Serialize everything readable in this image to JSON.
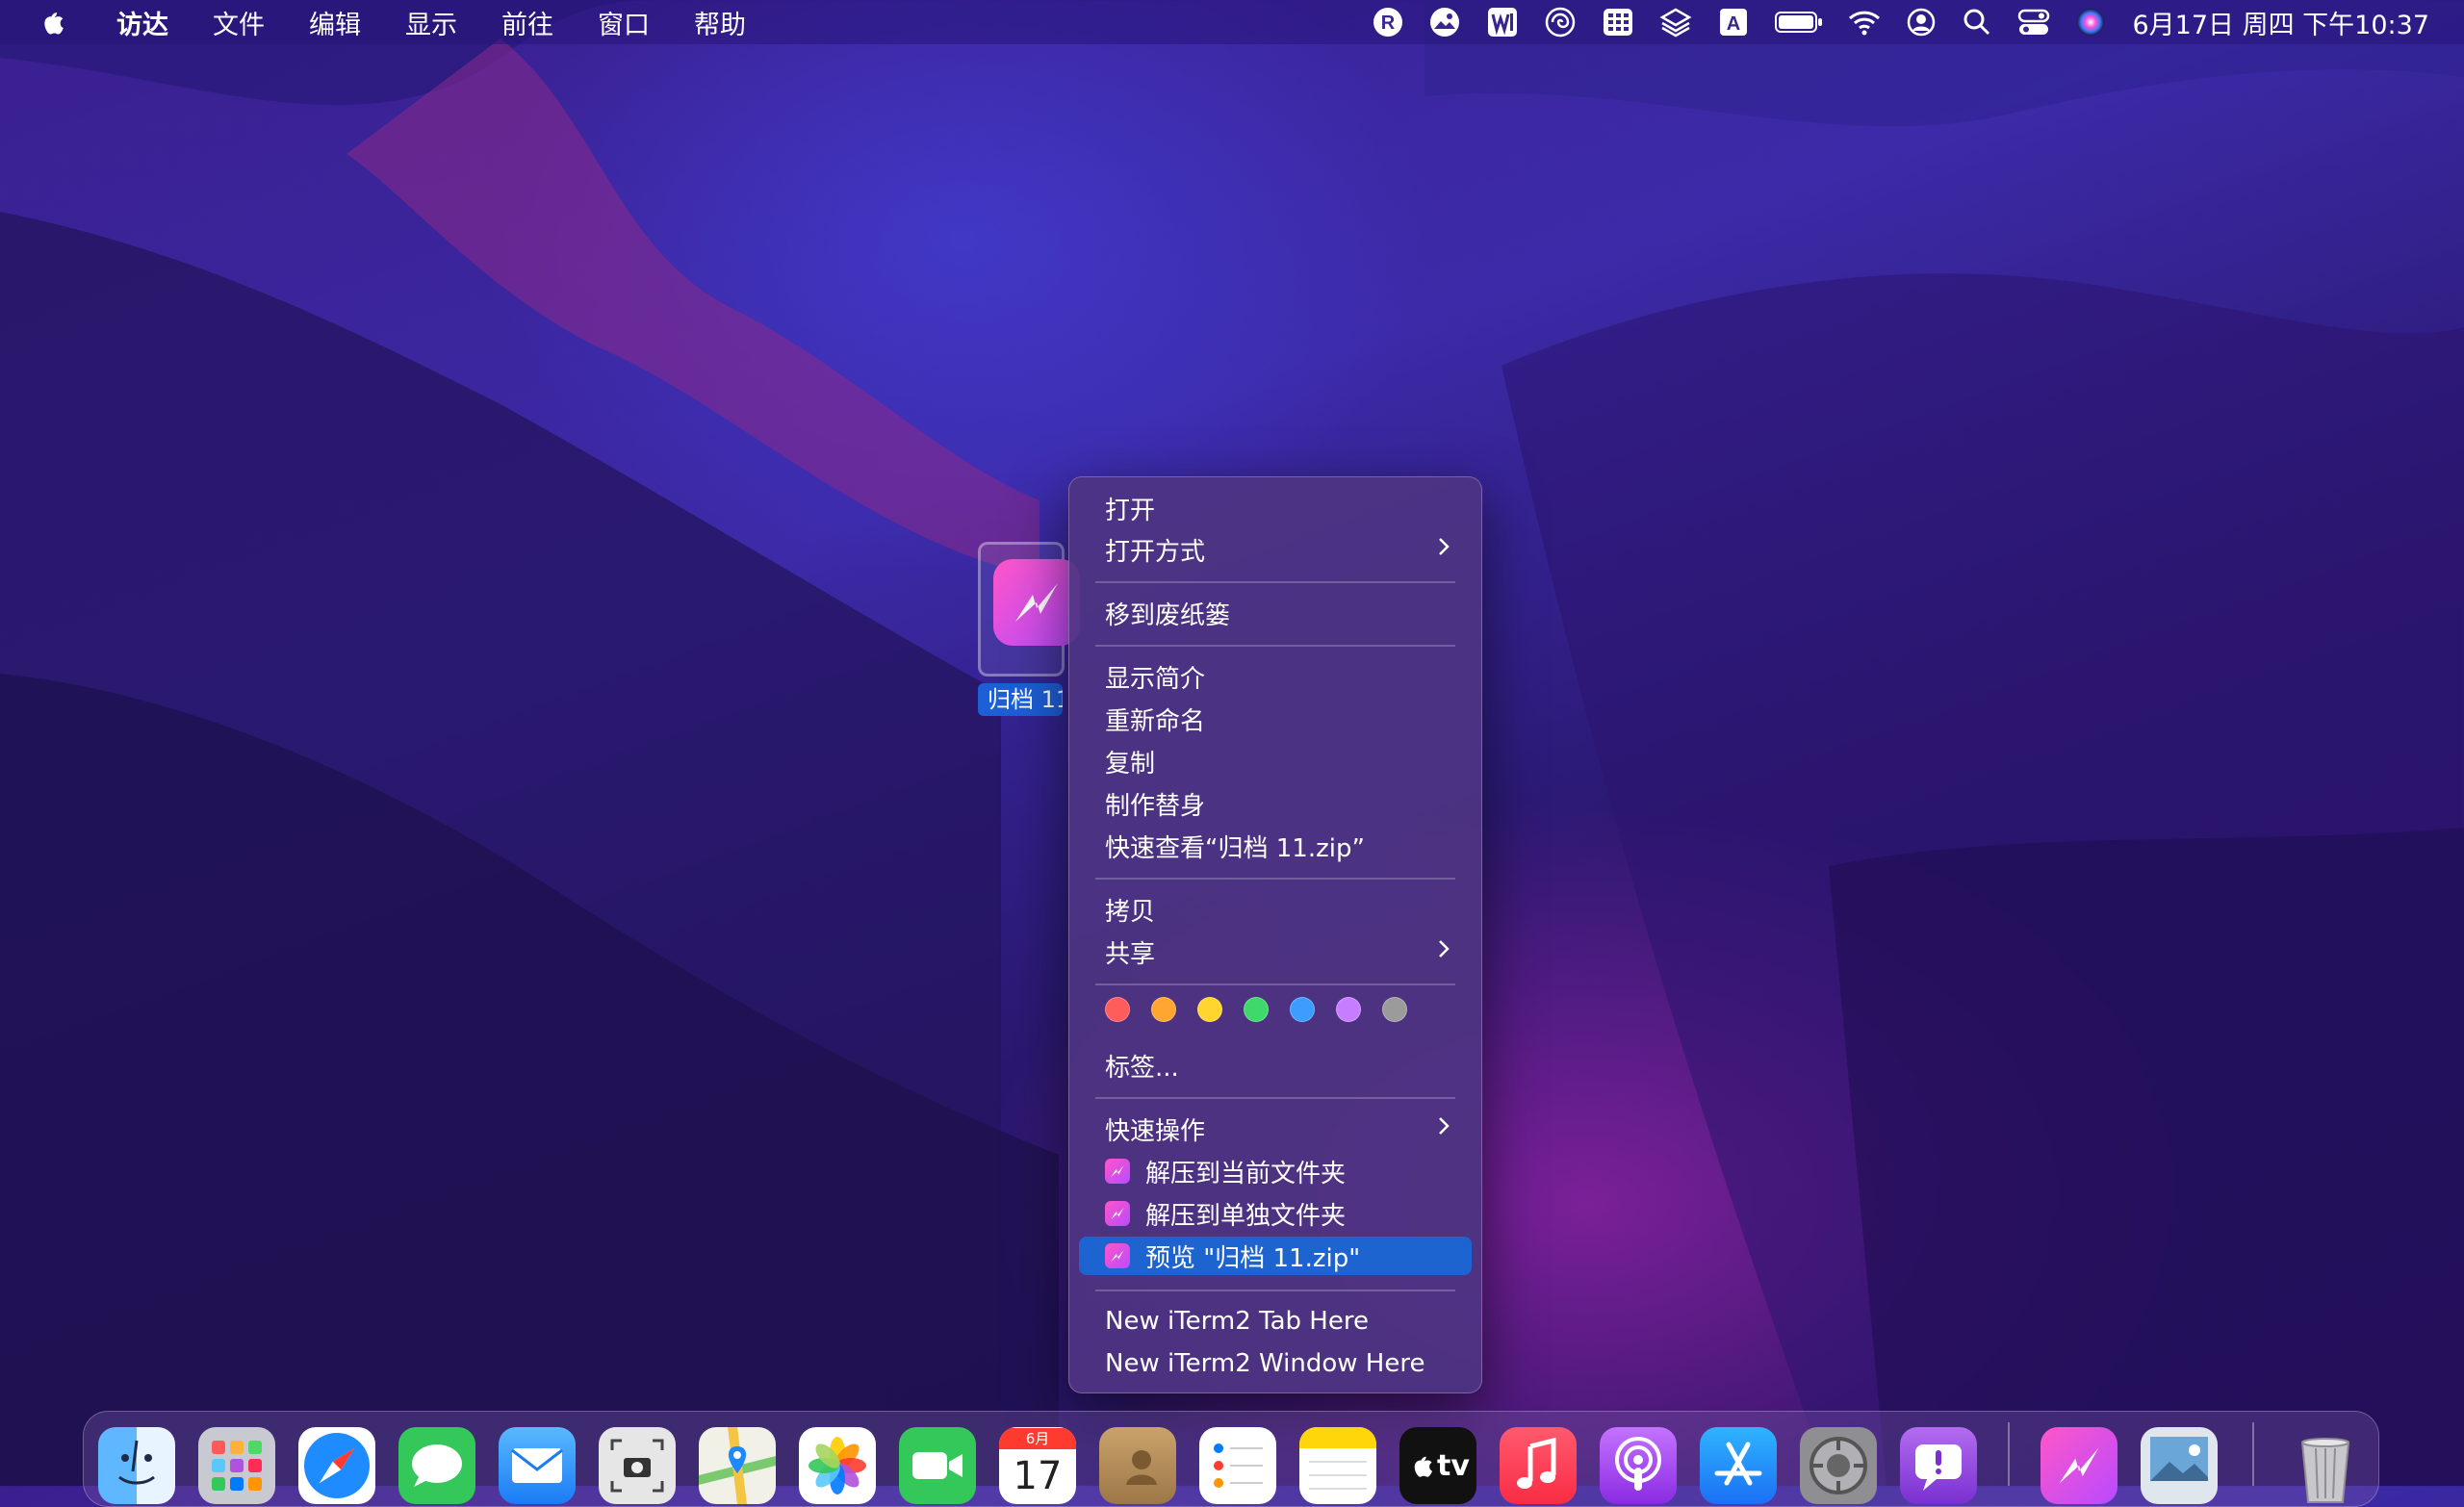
{
  "menubar": {
    "app_name": "访达",
    "menus": [
      "文件",
      "编辑",
      "显示",
      "前往",
      "窗口",
      "帮助"
    ],
    "status_icons": [
      "r-icon",
      "picture-icon",
      "w-icon",
      "swirl-icon",
      "grid-icon",
      "layers-icon",
      "a-keyboard-icon",
      "battery-icon",
      "wifi-icon",
      "user-icon",
      "search-icon",
      "control-center-icon",
      "siri-icon"
    ],
    "clock": "6月17日 周四 下午10:37"
  },
  "desktop": {
    "file_label": "归档 11."
  },
  "context_menu": {
    "open": "打开",
    "open_with": "打开方式",
    "move_to_trash": "移到废纸篓",
    "get_info": "显示简介",
    "rename": "重新命名",
    "duplicate": "复制",
    "make_alias": "制作替身",
    "quick_look": "快速查看“归档 11.zip”",
    "copy": "拷贝",
    "share": "共享",
    "tag_colors": [
      "#ff5c5c",
      "#ffa630",
      "#ffd52e",
      "#3fd96b",
      "#3d9cff",
      "#c77dff",
      "#9b9b9b"
    ],
    "tags": "标签...",
    "quick_actions": "快速操作",
    "extract_here": "解压到当前文件夹",
    "extract_separate": "解压到单独文件夹",
    "preview": "预览 \"归档 11.zip\"",
    "iterm_tab": "New iTerm2 Tab Here",
    "iterm_window": "New iTerm2 Window Here"
  },
  "dock": {
    "calendar_month": "6月",
    "calendar_day": "17",
    "tv_label": "tv",
    "apps": [
      "finder-icon",
      "launchpad-icon",
      "safari-icon",
      "messages-icon",
      "mail-icon",
      "screenshot-icon",
      "maps-icon",
      "photos-icon",
      "facetime-icon",
      "calendar-icon",
      "contacts-icon",
      "reminders-icon",
      "notes-icon",
      "apple-tv-icon",
      "music-icon",
      "podcasts-icon",
      "app-store-icon",
      "system-preferences-icon",
      "feedback-icon",
      "unarchiver-icon",
      "preview-icon",
      "trash-icon"
    ]
  }
}
